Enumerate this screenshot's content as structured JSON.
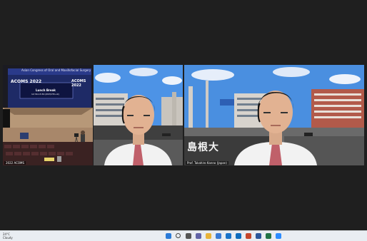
{
  "window": {
    "title": ""
  },
  "participants": [
    {
      "id": "p1",
      "name": "2022 ACOMS",
      "content": "presentation-hall",
      "slide": {
        "banner": "Asian Congress of Oral and Maxillofacial Surgery",
        "logo_left": "ACOMS 2022",
        "logo_right": "ACOMS 2022",
        "center_title": "Lunch Break",
        "center_sub": "12:30-13:30 (KST/UTC+9)"
      }
    },
    {
      "id": "p2",
      "name": "",
      "content": "speaker-camera"
    },
    {
      "id": "p3",
      "name": "Prof. Takahiro Kanno (Japan)",
      "content": "speaker-camera",
      "background_sign": "島根大"
    }
  ],
  "taskbar": {
    "weather_temp": "24°C",
    "weather_cond": "Cloudy",
    "icons": [
      "windows-start-icon",
      "search-icon",
      "task-view-icon",
      "chat-icon",
      "file-explorer-icon",
      "store-icon",
      "mail-icon",
      "outlook-icon",
      "powerpoint-icon",
      "word-icon",
      "excel-icon",
      "zoom-icon"
    ]
  },
  "colors": {
    "app_bg": "#1f1f1f",
    "taskbar_bg": "#e9edf2",
    "sky": "#4a8fe0",
    "shirt": "#f2f2f2",
    "tie": "#c0606a",
    "slide_bg": "#1e2a66"
  }
}
